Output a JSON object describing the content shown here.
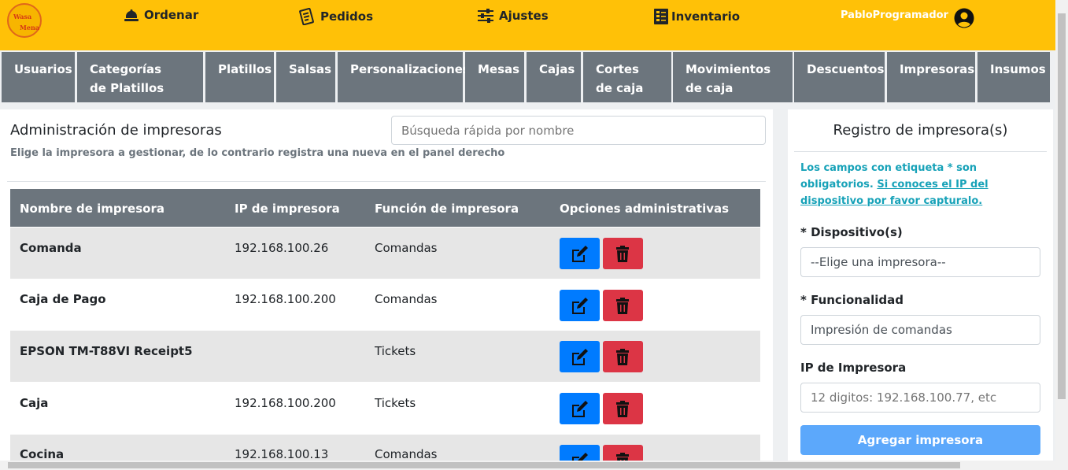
{
  "topbar": {
    "logo_text": [
      "Wasa",
      "Mena"
    ],
    "nav": [
      {
        "label": "Ordenar",
        "icon": "bell-icon"
      },
      {
        "label": "Pedidos",
        "icon": "receipt-icon"
      },
      {
        "label": "Ajustes",
        "icon": "sliders-icon"
      },
      {
        "label": "Inventario",
        "icon": "inventory-icon"
      }
    ],
    "username": "PabloProgramador"
  },
  "tabs": [
    "Usuarios",
    "Categorías de Platillos",
    "Platillos",
    "Salsas",
    "Personalizaciones",
    "Mesas",
    "Cajas",
    "Cortes de caja",
    "Movimientos de caja",
    "Descuentos",
    "Impresoras",
    "Insumos"
  ],
  "main": {
    "title": "Administración de impresoras",
    "subtitle": "Elige la impresora a gestionar, de lo contrario registra una nueva en el panel derecho",
    "search_placeholder": "Búsqueda rápida por nombre"
  },
  "table": {
    "headers": [
      "Nombre de impresora",
      "IP de impresora",
      "Función de impresora",
      "Opciones administrativas"
    ],
    "rows": [
      {
        "name": "Comanda",
        "ip": "192.168.100.26",
        "func": "Comandas"
      },
      {
        "name": "Caja de Pago",
        "ip": "192.168.100.200",
        "func": "Comandas"
      },
      {
        "name": "EPSON TM-T88VI Receipt5",
        "ip": "",
        "func": "Tickets"
      },
      {
        "name": "Caja",
        "ip": "192.168.100.200",
        "func": "Tickets"
      },
      {
        "name": "Cocina",
        "ip": "192.168.100.13",
        "func": "Comandas"
      }
    ]
  },
  "form": {
    "title": "Registro de impresora(s)",
    "info": "Los campos con etiqueta * son obligatorios. ",
    "info_link": "Si conoces el IP del dispositivo por favor capturalo.",
    "device_label": "* Dispositivo(s)",
    "device_value": "--Elige una impresora--",
    "func_label": "* Funcionalidad",
    "func_value": "Impresión de comandas",
    "ip_label": "IP de Impresora",
    "ip_placeholder": "12 digitos: 192.168.100.77, etc",
    "submit": "Agregar impresora"
  },
  "colors": {
    "topbar": "#ffc107",
    "tab": "#6c757d",
    "edit": "#007bff",
    "delete": "#dc3545",
    "info": "#17a2b8",
    "submit": "#5ca8fb"
  }
}
